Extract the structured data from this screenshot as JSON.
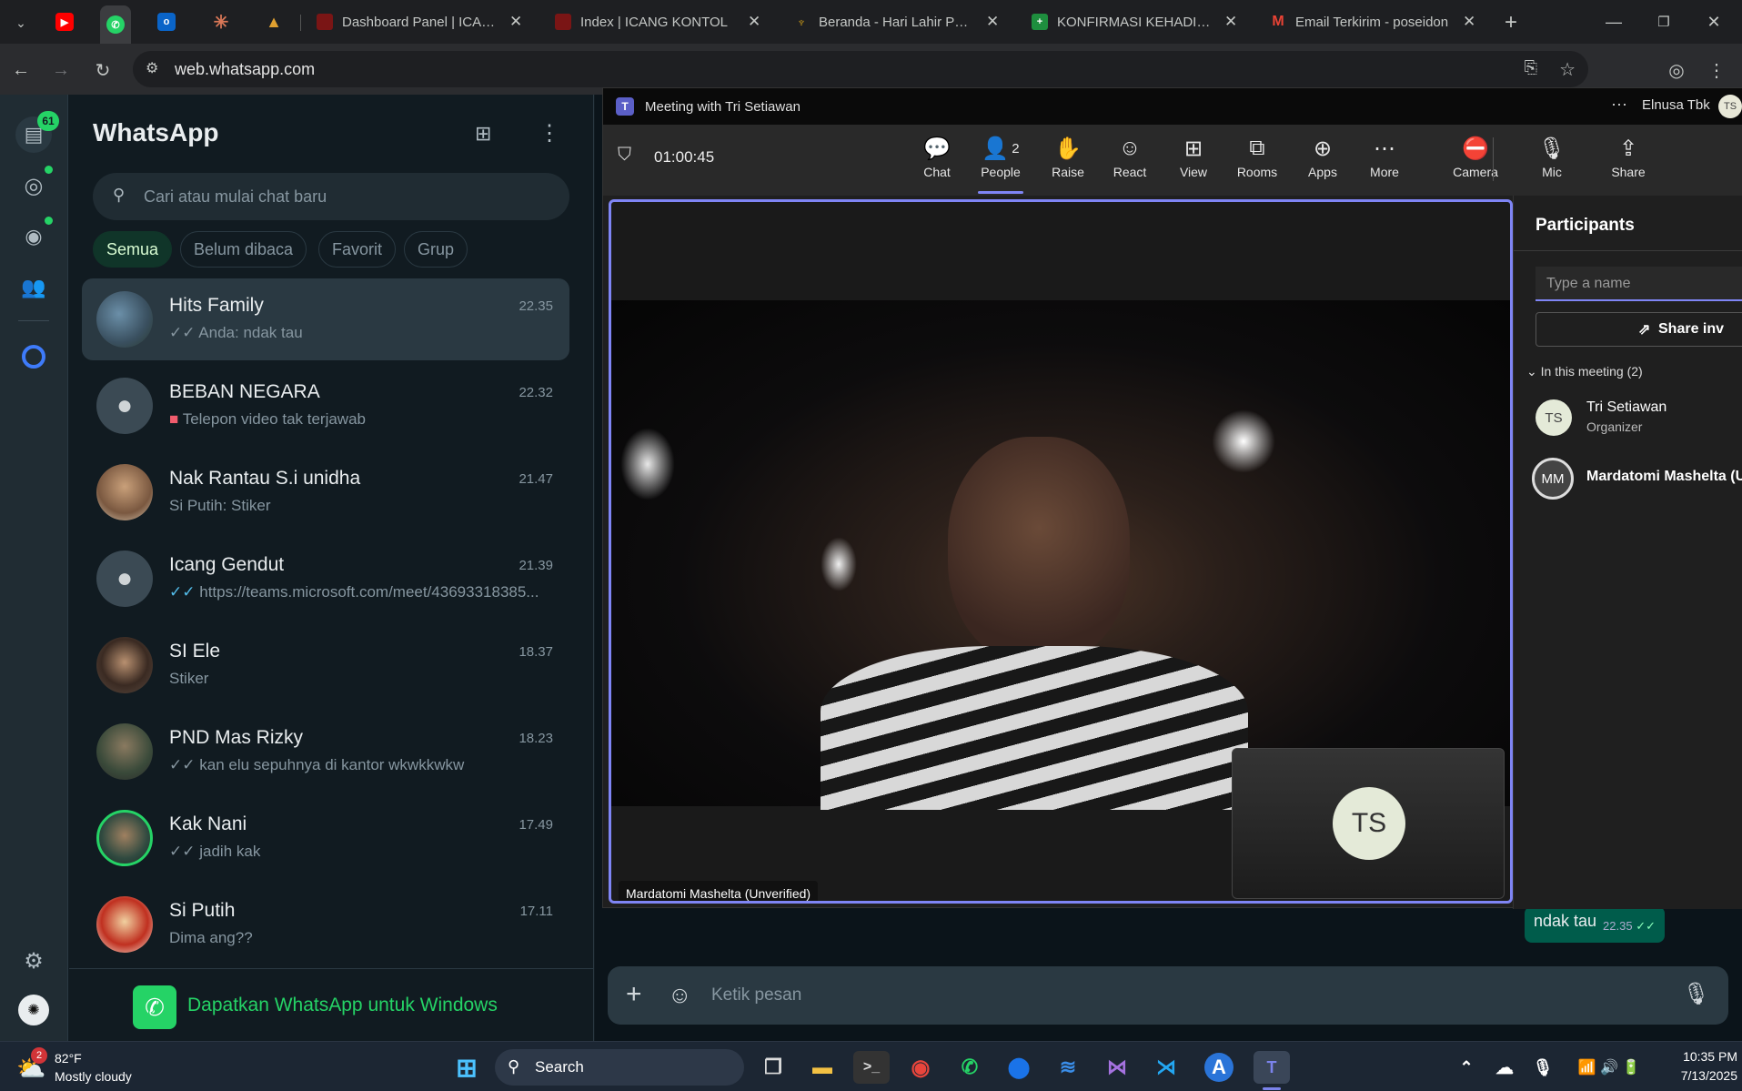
{
  "browser": {
    "tabs": [
      {
        "title": "Dashboard Panel | ICANG",
        "icon": "red-square-icon"
      },
      {
        "title": "Index | ICANG KONTOL",
        "icon": "red-square-icon"
      },
      {
        "title": "Beranda - Hari Lahir Panca",
        "icon": "garuda-icon"
      },
      {
        "title": "KONFIRMASI KEHADIRAN",
        "icon": "sheets-icon"
      },
      {
        "title": "Email Terkirim - poseidon",
        "icon": "gmail-icon"
      }
    ],
    "url": "web.whatsapp.com"
  },
  "whatsapp": {
    "rail": {
      "chats_badge": "61"
    },
    "title": "WhatsApp",
    "search_placeholder": "Cari atau mulai chat baru",
    "filters": [
      "Semua",
      "Belum dibaca",
      "Favorit",
      "Grup"
    ],
    "chats": [
      {
        "name": "Hits Family",
        "time": "22.35",
        "message": "Anda: ndak tau",
        "tick": "✓✓"
      },
      {
        "name": "BEBAN NEGARA",
        "time": "22.32",
        "message": "Telepon video tak terjawab",
        "tick": ""
      },
      {
        "name": "Nak Rantau S.i unidha",
        "time": "21.47",
        "message": "Si Putih: Stiker",
        "tick": ""
      },
      {
        "name": "Icang Gendut",
        "time": "21.39",
        "message": "https://teams.microsoft.com/meet/43693318385...",
        "tick": "✓✓"
      },
      {
        "name": "SI Ele",
        "time": "18.37",
        "message": "Stiker",
        "tick": ""
      },
      {
        "name": "PND Mas Rizky",
        "time": "18.23",
        "message": "kan elu sepuhnya di kantor wkwkkwkw",
        "tick": "✓✓"
      },
      {
        "name": "Kak Nani",
        "time": "17.49",
        "message": "jadih kak",
        "tick": "✓✓"
      },
      {
        "name": "Si Putih",
        "time": "17.11",
        "message": "Dima ang??",
        "tick": ""
      }
    ],
    "promo": "Dapatkan WhatsApp untuk Windows",
    "composer_placeholder": "Ketik pesan",
    "last_message": {
      "text": "ndak tau",
      "time": "22.35"
    }
  },
  "teams": {
    "window_title": "Meeting with Tri Setiawan",
    "org": "Elnusa Tbk",
    "user_initials": "TS",
    "timer": "01:00:45",
    "toolbar": [
      {
        "label": "Chat",
        "icon": "chat-icon"
      },
      {
        "label": "People",
        "icon": "people-icon",
        "count": "2"
      },
      {
        "label": "Raise",
        "icon": "hand-icon"
      },
      {
        "label": "React",
        "icon": "smile-icon"
      },
      {
        "label": "View",
        "icon": "grid-icon"
      },
      {
        "label": "Rooms",
        "icon": "rooms-icon"
      },
      {
        "label": "Apps",
        "icon": "plus-box-icon"
      },
      {
        "label": "More",
        "icon": "more-icon"
      },
      {
        "label": "Camera",
        "icon": "camera-off-icon"
      },
      {
        "label": "Mic",
        "icon": "mic-icon"
      },
      {
        "label": "Share",
        "icon": "share-icon"
      }
    ],
    "speaker_name": "Mardatomi Mashelta (Unverified)",
    "self_initials": "TS",
    "participants": {
      "title": "Participants",
      "search_placeholder": "Type a name",
      "share_label": "Share inv",
      "section": "In this meeting (2)",
      "list": [
        {
          "initials": "TS",
          "name": "Tri Setiawan",
          "role": "Organizer"
        },
        {
          "initials": "MM",
          "name": "Mardatomi Mashelta (U",
          "role": ""
        }
      ]
    }
  },
  "taskbar": {
    "weather_temp": "82°F",
    "weather_desc": "Mostly cloudy",
    "weather_badge": "2",
    "search": "Search",
    "time": "10:35 PM",
    "date": "7/13/2025"
  }
}
